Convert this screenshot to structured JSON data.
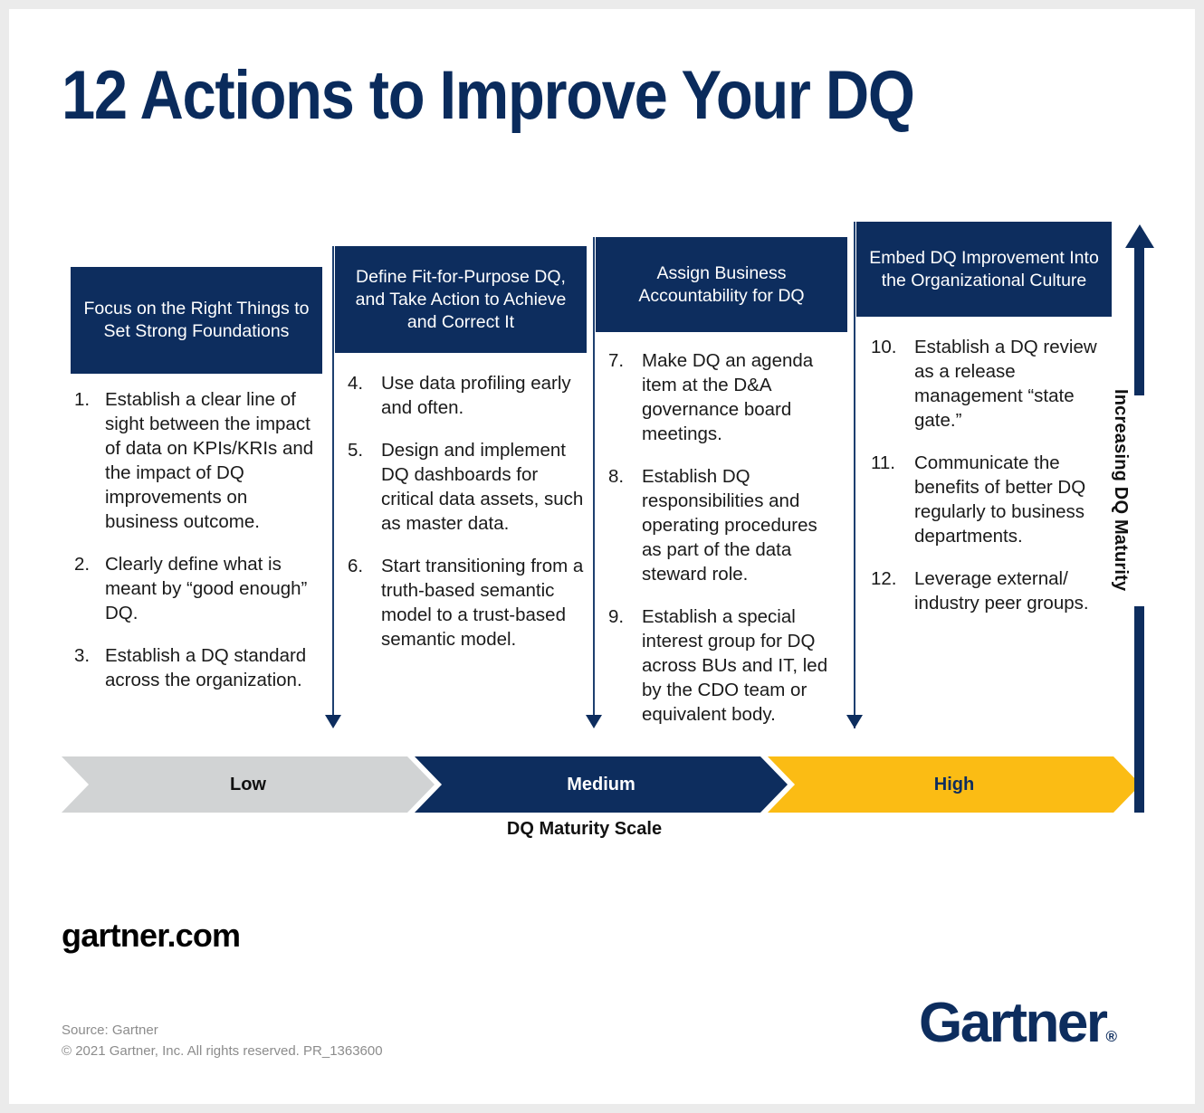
{
  "page": {
    "title": "12 Actions to Improve Your DQ",
    "background": "#ffffff",
    "frame_color": "#ebebeb"
  },
  "colors": {
    "navy": "#0d2d5e",
    "gray": "#d1d3d4",
    "yellow": "#fbbc14",
    "body_text": "#1a1a1a",
    "muted_text": "#8c8c8c"
  },
  "columns": [
    {
      "header": "Focus on the Right Things to Set Strong Foundations",
      "items": [
        {
          "num": "1.",
          "text": "Establish a clear line of sight between the impact of data on KPIs/KRIs and the impact of DQ improvements on business outcome."
        },
        {
          "num": "2.",
          "text": "Clearly define what is meant by “good enough” DQ."
        },
        {
          "num": "3.",
          "text": "Establish a DQ standard across the organization."
        }
      ]
    },
    {
      "header": "Define Fit-for-Purpose DQ, and Take Action to Achieve and Correct It",
      "items": [
        {
          "num": "4.",
          "text": "Use data profiling early and often."
        },
        {
          "num": "5.",
          "text": "Design and implement DQ dashboards for critical data assets, such as master data."
        },
        {
          "num": "6.",
          "text": "Start transitioning from a truth-based semantic model to a trust-based semantic model."
        }
      ]
    },
    {
      "header": "Assign Business Accountability for DQ",
      "items": [
        {
          "num": "7.",
          "text": "Make DQ an agenda item at the D&A governance board meetings."
        },
        {
          "num": "8.",
          "text": "Establish DQ responsibilities and operating procedures as part of the data steward role."
        },
        {
          "num": "9.",
          "text": "Establish a special interest group for DQ across BUs and IT, led by the CDO team or equivalent body."
        }
      ]
    },
    {
      "header": "Embed DQ Improvement Into the Organizational Culture",
      "items": [
        {
          "num": "10.",
          "text": "Establish a DQ review as a release management “state gate.”"
        },
        {
          "num": "11.",
          "text": "Communicate the benefits of better DQ regularly to business departments."
        },
        {
          "num": "12.",
          "text": "Leverage external/ industry peer groups."
        }
      ]
    }
  ],
  "scale": {
    "caption": "DQ Maturity Scale",
    "segments": [
      {
        "label": "Low",
        "fill": "#d1d3d4",
        "text_color": "#111111"
      },
      {
        "label": "Medium",
        "fill": "#0d2d5e",
        "text_color": "#ffffff"
      },
      {
        "label": "High",
        "fill": "#fbbc14",
        "text_color": "#0d2d5e"
      }
    ]
  },
  "axis": {
    "label": "Increasing DQ Maturity"
  },
  "footer": {
    "site": "gartner.com",
    "source": "Source: Gartner",
    "copyright": "© 2021 Gartner, Inc. All rights reserved. PR_1363600",
    "logo": "Gartner",
    "logo_mark": "®"
  }
}
